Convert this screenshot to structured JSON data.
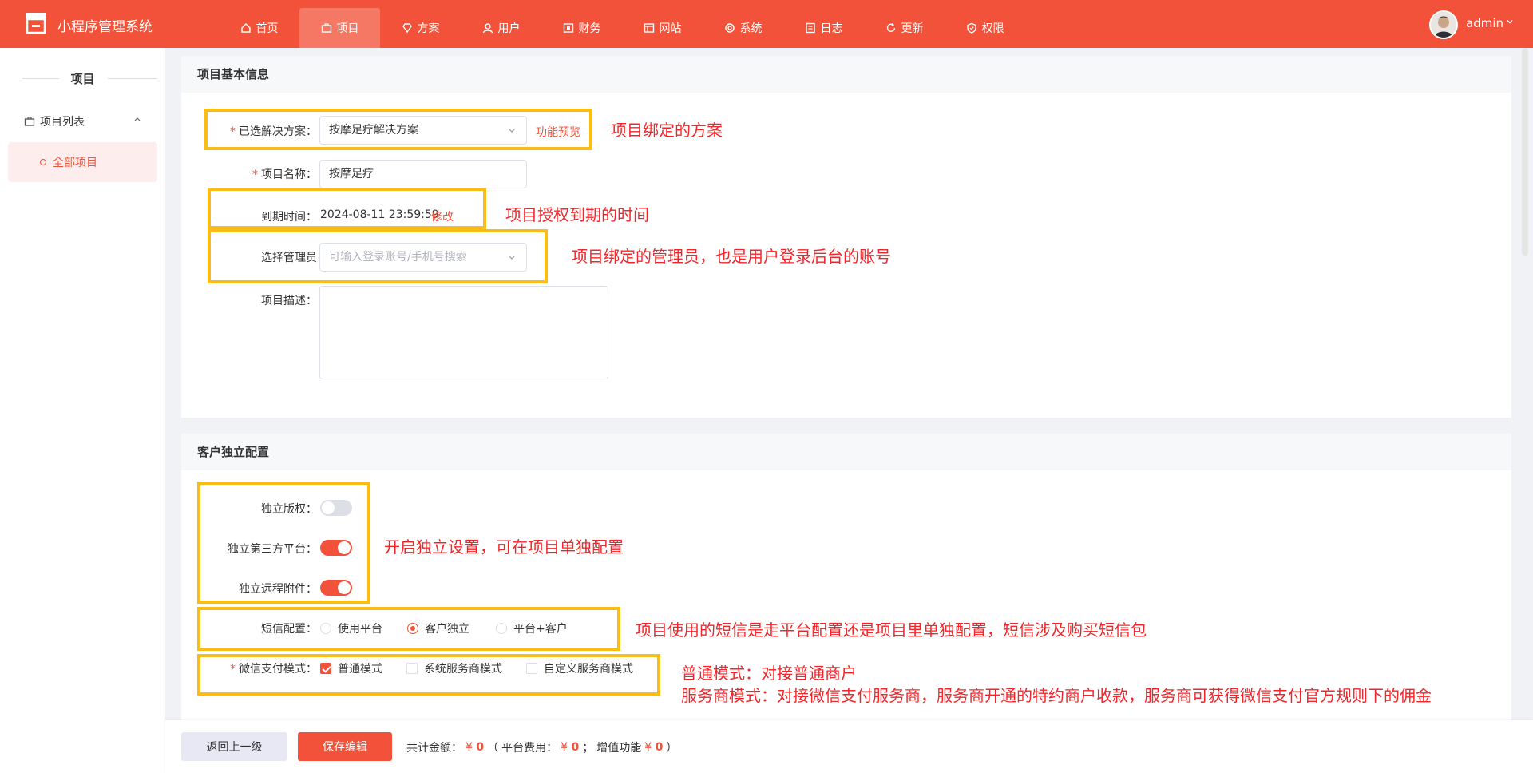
{
  "header": {
    "app_title": "小程序管理系统",
    "nav": [
      {
        "label": "首页",
        "icon": "home-icon"
      },
      {
        "label": "项目",
        "icon": "briefcase-icon"
      },
      {
        "label": "方案",
        "icon": "diamond-icon"
      },
      {
        "label": "用户",
        "icon": "users-icon"
      },
      {
        "label": "财务",
        "icon": "wallet-icon"
      },
      {
        "label": "网站",
        "icon": "browser-icon"
      },
      {
        "label": "系统",
        "icon": "gear-icon"
      },
      {
        "label": "日志",
        "icon": "document-icon"
      },
      {
        "label": "更新",
        "icon": "refresh-icon"
      },
      {
        "label": "权限",
        "icon": "shield-icon"
      }
    ],
    "active_nav": "项目",
    "user": "admin"
  },
  "sidebar": {
    "heading": "项目",
    "group": "项目列表",
    "item": "全部项目"
  },
  "basic": {
    "title": "项目基本信息",
    "solution_label": "已选解决方案：",
    "solution_value": "按摩足疗解决方案",
    "preview_link": "功能预览",
    "name_label": "项目名称：",
    "name_value": "按摩足疗",
    "expire_label": "到期时间：",
    "expire_value": "2024-08-11 23:59:59",
    "expire_edit": "修改",
    "admin_label": "选择管理员",
    "admin_placeholder": "可输入登录账号/手机号搜索",
    "desc_label": "项目描述："
  },
  "custom": {
    "title": "客户独立配置",
    "copyright_label": "独立版权：",
    "copyright_on": false,
    "thirdparty_label": "独立第三方平台：",
    "thirdparty_on": true,
    "remote_label": "独立远程附件：",
    "remote_on": true,
    "sms_label": "短信配置：",
    "sms_options": [
      "使用平台",
      "客户独立",
      "平台+客户"
    ],
    "sms_selected": "客户独立",
    "wxpay_label": "微信支付模式：",
    "wxpay_options": [
      "普通模式",
      "系统服务商模式",
      "自定义服务商模式"
    ],
    "wxpay_selected": "普通模式"
  },
  "annotations": {
    "solution": "项目绑定的方案",
    "expire": "项目授权到期的时间",
    "admin": "项目绑定的管理员，也是用户登录后台的账号",
    "independent": "开启独立设置，可在项目单独配置",
    "sms": "项目使用的短信是走平台配置还是项目里单独配置，短信涉及购买短信包",
    "wxpay_line1": "普通模式：对接普通商户",
    "wxpay_line2": "服务商模式：对接微信支付服务商，服务商开通的特约商户收款，服务商可获得微信支付官方规则下的佣金",
    "color": "#f2262a",
    "box_color": "#fbbd15"
  },
  "footer": {
    "back_label": "返回上一级",
    "save_label": "保存编辑",
    "total_label": "共计金额：",
    "total_value": "0",
    "platform_label": "平台费用：",
    "platform_value": "0",
    "addon_label": "增值功能",
    "addon_value": "0",
    "currency": "¥"
  },
  "colors": {
    "brand": "#f2523a"
  }
}
